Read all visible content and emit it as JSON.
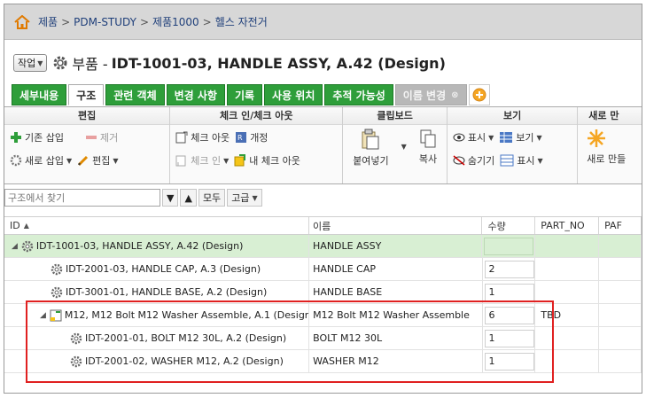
{
  "breadcrumb": [
    "제품",
    "PDM-STUDY",
    "제품1000",
    "헬스 자전거"
  ],
  "title": {
    "action_label": "작업",
    "prefix": "부품 -",
    "main": "IDT-1001-03, HANDLE ASSY, A.42 (Design)"
  },
  "tabs": [
    {
      "label": "세부내용"
    },
    {
      "label": "구조"
    },
    {
      "label": "관련 객체"
    },
    {
      "label": "변경 사항"
    },
    {
      "label": "기록"
    },
    {
      "label": "사용 위치"
    },
    {
      "label": "추적 가능성"
    },
    {
      "label": "이름 변경"
    }
  ],
  "ribbon": {
    "edit": {
      "title": "편집",
      "insert_existing": "기존 삽입",
      "remove": "제거",
      "insert_new": "새로 삽입",
      "edit": "편집"
    },
    "checkin": {
      "title": "체크 인/체크 아웃",
      "checkout": "체크 아웃",
      "revise": "개정",
      "checkin": "체크 인",
      "my_checkout": "내 체크 아웃"
    },
    "clipboard": {
      "title": "클립보드",
      "paste": "붙여넣기",
      "copy": "복사"
    },
    "view": {
      "title": "보기",
      "show": "표시",
      "view": "보기",
      "hide": "숨기기",
      "display": "표시"
    },
    "new": {
      "title": "새로 만",
      "new_label": "새로 만들"
    }
  },
  "search": {
    "placeholder": "구조에서 찾기",
    "all_label": "모두",
    "advanced_label": "고급"
  },
  "table": {
    "columns": [
      "ID",
      "이름",
      "수량",
      "PART_NO",
      "PAF"
    ],
    "rows": [
      {
        "id": "IDT-1001-03, HANDLE ASSY, A.42 (Design)",
        "name": "HANDLE ASSY",
        "qty": "",
        "part_no": ""
      },
      {
        "id": "IDT-2001-03, HANDLE CAP, A.3 (Design)",
        "name": "HANDLE CAP",
        "qty": "2",
        "part_no": ""
      },
      {
        "id": "IDT-3001-01, HANDLE BASE, A.2 (Design)",
        "name": "HANDLE BASE",
        "qty": "1",
        "part_no": ""
      },
      {
        "id": "M12, M12 Bolt M12 Washer Assemble, A.1 (Design)",
        "name": "M12 Bolt M12 Washer Assemble",
        "qty": "6",
        "part_no": "TBD"
      },
      {
        "id": "IDT-2001-01, BOLT M12 30L, A.2 (Design)",
        "name": "BOLT M12 30L",
        "qty": "1",
        "part_no": ""
      },
      {
        "id": "IDT-2001-02, WASHER M12, A.2 (Design)",
        "name": "WASHER M12",
        "qty": "1",
        "part_no": ""
      }
    ]
  },
  "colors": {
    "tab_green": "#2e9e3a",
    "selected_row": "#d8efd3",
    "highlight": "#e02020"
  }
}
